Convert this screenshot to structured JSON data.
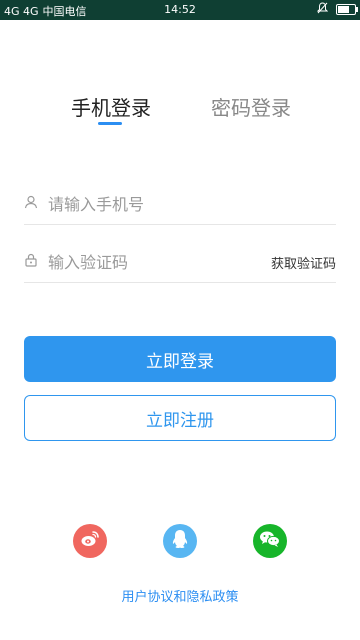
{
  "status_bar": {
    "signal_text": "4G 4G",
    "carrier": "中国电信",
    "time": "14:52"
  },
  "tabs": {
    "phone_label": "手机登录",
    "password_label": "密码登录"
  },
  "form": {
    "phone_placeholder": "请输入手机号",
    "code_placeholder": "输入验证码",
    "get_code_label": "获取验证码"
  },
  "buttons": {
    "login_label": "立即登录",
    "register_label": "立即注册"
  },
  "social": {
    "icons": [
      "weibo-icon",
      "qq-icon",
      "wechat-icon"
    ]
  },
  "footer": {
    "agreement_label": "用户协议和隐私政策"
  },
  "colors": {
    "accent": "#2f96ee",
    "status_bar": "#0f3f33",
    "weibo": "#f0675f",
    "qq": "#58b6f2",
    "wechat": "#17b52a"
  }
}
